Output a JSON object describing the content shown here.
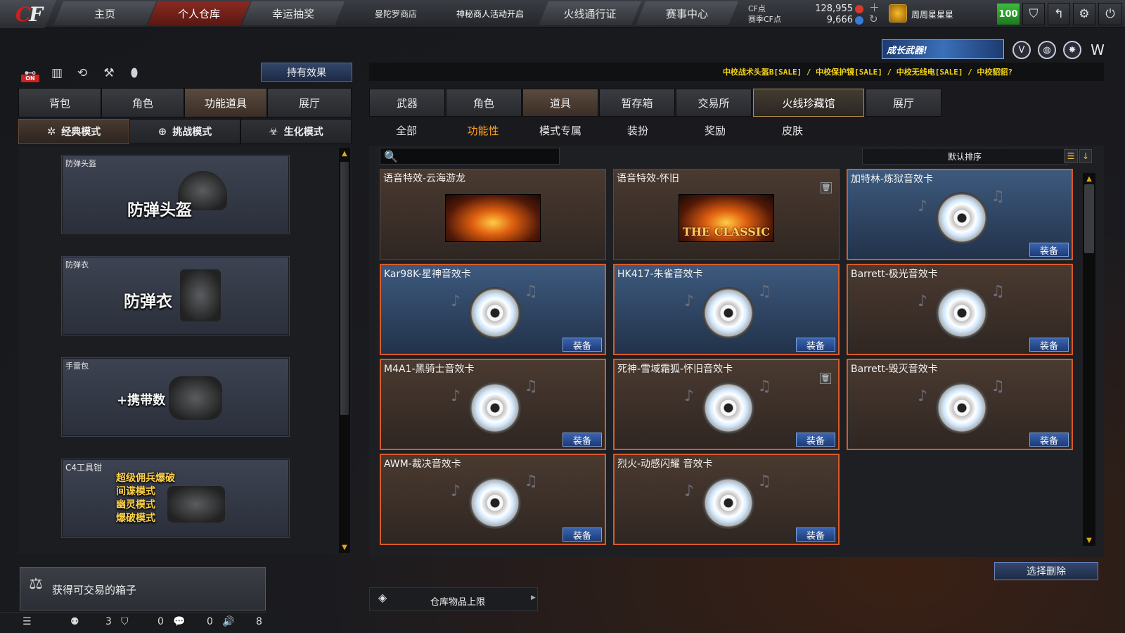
{
  "logo": {
    "text": "CF"
  },
  "nav": {
    "tabs": [
      "主页",
      "个人仓库",
      "幸运抽奖",
      "曼陀罗商店",
      "神秘商人活动开启",
      "火线通行证",
      "赛事中心"
    ],
    "active": "个人仓库"
  },
  "currency": {
    "cf_label": "CF点",
    "season_label": "赛季CF点",
    "cf_value": "128,955",
    "season_value": "9,666"
  },
  "user": {
    "name": "周周星星星",
    "level": "100"
  },
  "left": {
    "effects_button": "持有效果",
    "on_badge": "ON",
    "categories": [
      "背包",
      "角色",
      "功能道具",
      "展厅"
    ],
    "active_category": "功能道具",
    "modes": [
      "经典模式",
      "挑战模式",
      "生化模式"
    ],
    "active_mode": "经典模式",
    "items": [
      {
        "label": "防弹头盔",
        "title": "防弹头盔"
      },
      {
        "label": "防弹衣",
        "title": "防弹衣"
      },
      {
        "label": "手雷包",
        "title": "+携带数"
      },
      {
        "label": "C4工具钳",
        "lines": [
          "超级佣兵爆破",
          "间谍模式",
          "幽灵模式",
          "爆破模式"
        ]
      }
    ],
    "notice": "获得可交易的箱子",
    "status": {
      "c1": "3",
      "c2": "0",
      "c3": "0",
      "c4": "8"
    }
  },
  "right": {
    "promo": "成长武器!",
    "ticker": "中校战术头盔B[SALE] / 中校保护镜[SALE] / 中校无线电[SALE] / 中校貂貂?",
    "categories": [
      "武器",
      "角色",
      "道具",
      "暂存箱",
      "交易所",
      "火线珍藏馆",
      "展厅"
    ],
    "active_category": "道具",
    "special_category": "火线珍藏馆",
    "subtabs": [
      "全部",
      "功能性",
      "模式专属",
      "装扮",
      "奖励",
      "皮肤"
    ],
    "active_subtab": "功能性",
    "sort_label": "默认排序",
    "search_placeholder": "",
    "equip_label": "装备",
    "cards": [
      {
        "title": "语音特效-云海游龙",
        "kind": "fx",
        "img_text": ""
      },
      {
        "title": "语音特效-怀旧",
        "kind": "fx",
        "img_text": "THE CLASSIC"
      },
      {
        "title": "加特林-炼狱音效卡",
        "kind": "disc"
      },
      {
        "title": "Kar98K-星神音效卡",
        "kind": "disc"
      },
      {
        "title": "HK417-朱雀音效卡",
        "kind": "disc"
      },
      {
        "title": "Barrett-极光音效卡",
        "kind": "disc"
      },
      {
        "title": "M4A1-黑骑士音效卡",
        "kind": "disc"
      },
      {
        "title": "死神-雪域霜狐-怀旧音效卡",
        "kind": "disc"
      },
      {
        "title": "Barrett-毁灭音效卡",
        "kind": "disc"
      },
      {
        "title": "AWM-裁决音效卡",
        "kind": "disc"
      },
      {
        "title": "烈火-动感闪耀 音效卡",
        "kind": "disc"
      }
    ],
    "delete_button": "选择删除",
    "capacity_label": "仓库物品上限"
  },
  "colors": {
    "accent_red": "#d21d1d",
    "highlight_orange": "#ffa020",
    "ticker_yellow": "#f1d21a",
    "level_green": "#3bbd3b"
  }
}
